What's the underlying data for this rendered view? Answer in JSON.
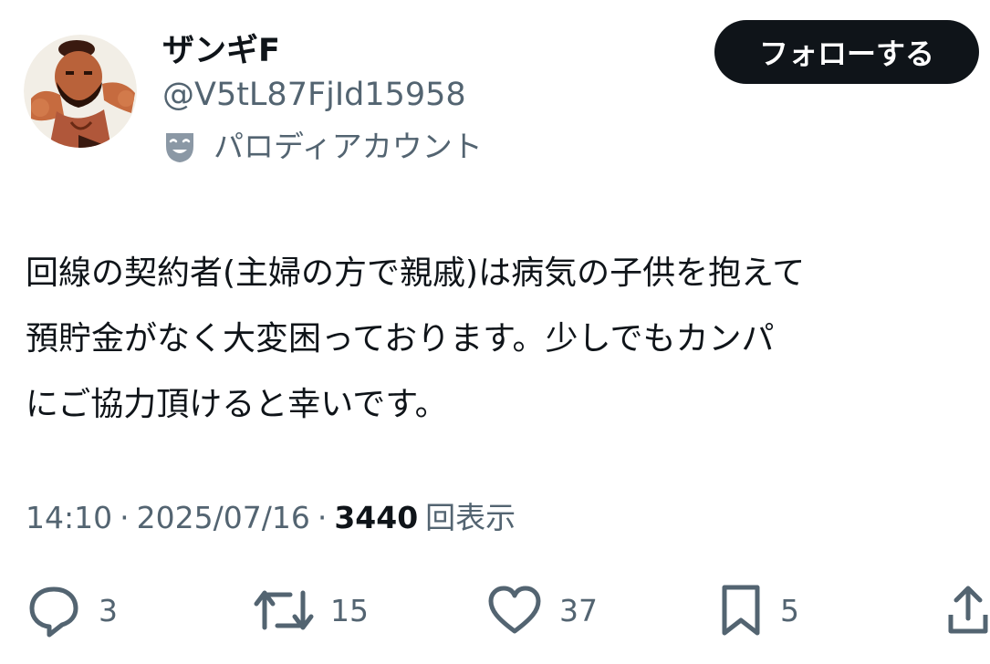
{
  "profile": {
    "display_name": "ザンギF",
    "handle": "@V5tL87FjId15958",
    "parody_label": "パロディアカウント",
    "follow_label": "フォローする"
  },
  "tweet": {
    "text_lines": [
      "回線の契約者(主婦の方で親戚)は病気の子供を抱えて",
      "預貯金がなく大変困っております。少しでもカンパ",
      "にご協力頂けると幸いです。"
    ],
    "time": "14:10",
    "separator": "·",
    "date": "2025/07/16",
    "views_count": "3440",
    "views_label": "回表示"
  },
  "actions": {
    "replies": "3",
    "retweets": "15",
    "likes": "37",
    "bookmarks": "5"
  },
  "colors": {
    "text_primary": "#0f1419",
    "text_secondary": "#536471",
    "follow_button_bg": "#0f1419",
    "follow_button_text": "#ffffff"
  },
  "icons": [
    "avatar",
    "parody-mask-icon",
    "reply-icon",
    "retweet-icon",
    "like-icon",
    "bookmark-icon",
    "share-icon"
  ]
}
